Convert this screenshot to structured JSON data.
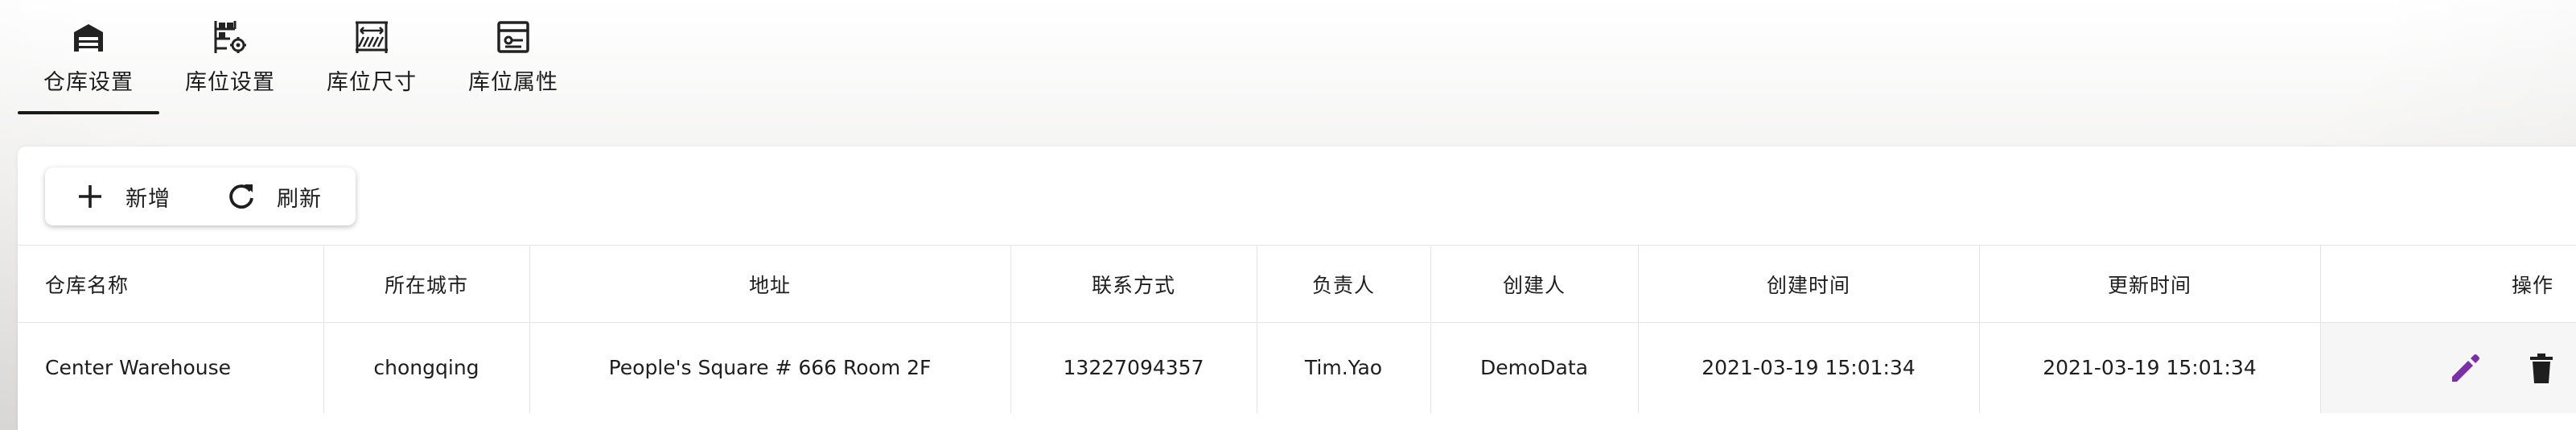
{
  "tabs": [
    {
      "label": "仓库设置",
      "icon": "warehouse-icon",
      "active": true
    },
    {
      "label": "库位设置",
      "icon": "location-settings-icon",
      "active": false
    },
    {
      "label": "库位尺寸",
      "icon": "location-size-icon",
      "active": false
    },
    {
      "label": "库位属性",
      "icon": "location-property-icon",
      "active": false
    }
  ],
  "toolbar": {
    "add_label": "新增",
    "refresh_label": "刷新"
  },
  "table": {
    "columns": [
      "仓库名称",
      "所在城市",
      "地址",
      "联系方式",
      "负责人",
      "创建人",
      "创建时间",
      "更新时间",
      "操作"
    ],
    "rows": [
      {
        "name": "Center Warehouse",
        "city": "chongqing",
        "address": "People's Square # 666 Room 2F",
        "contact": "13227094357",
        "manager": "Tim.Yao",
        "creator": "DemoData",
        "created": "2021-03-19 15:01:34",
        "updated": "2021-03-19 15:01:34"
      }
    ]
  },
  "colors": {
    "edit_icon": "#7b2fa6",
    "delete_icon": "#1e1e1e"
  }
}
